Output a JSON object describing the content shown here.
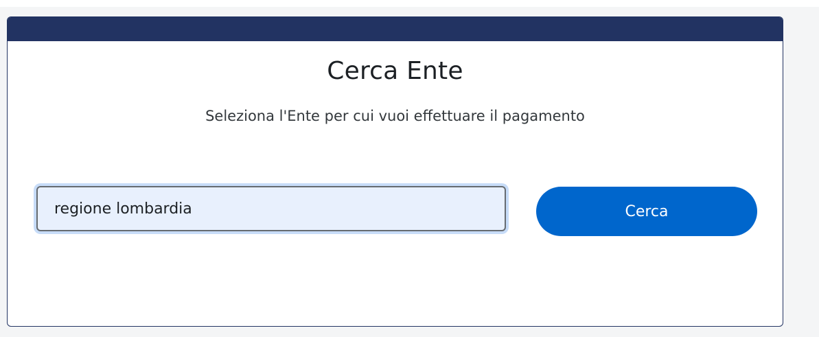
{
  "search_panel": {
    "title": "Cerca Ente",
    "subtitle": "Seleziona l'Ente per cui vuoi effettuare il pagamento",
    "search_input": {
      "value": "regione lombardia"
    },
    "search_button_label": "Cerca"
  },
  "colors": {
    "header_bar": "#223362",
    "primary_button": "#0066cc",
    "input_background": "#e8f0fd",
    "focus_ring": "#c7dcf8"
  }
}
